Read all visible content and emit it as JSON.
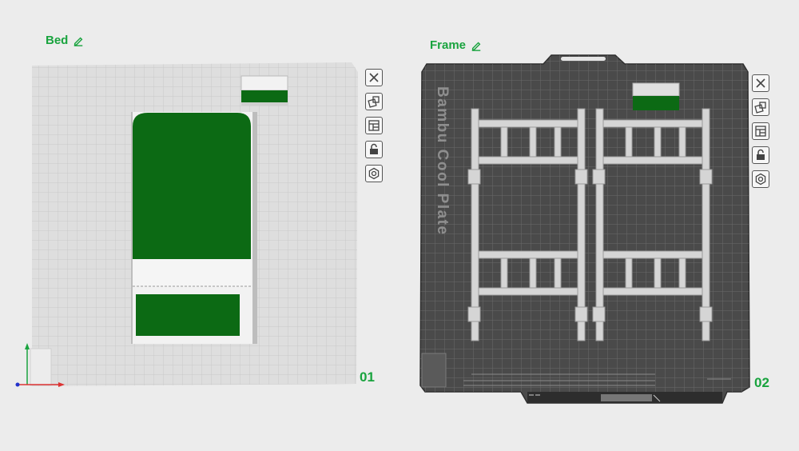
{
  "plates": [
    {
      "title": "Bed",
      "number": "01",
      "theme": "light",
      "objects": [
        "bed-model",
        "small-block"
      ]
    },
    {
      "title": "Frame",
      "number": "02",
      "theme": "dark",
      "plate_label": "Bambu Cool Plate",
      "objects": [
        "bunk-frame-left",
        "bunk-frame-right",
        "small-block"
      ]
    }
  ],
  "tools": [
    "close-icon",
    "auto-orient-icon",
    "arrange-icon",
    "lock-icon",
    "settings-icon"
  ],
  "colors": {
    "accent": "#19a33e",
    "model_green": "#0c6a14",
    "model_white": "#f2f2f2",
    "plate_light": "#d9d9d9",
    "plate_dark": "#4a4a4a"
  }
}
